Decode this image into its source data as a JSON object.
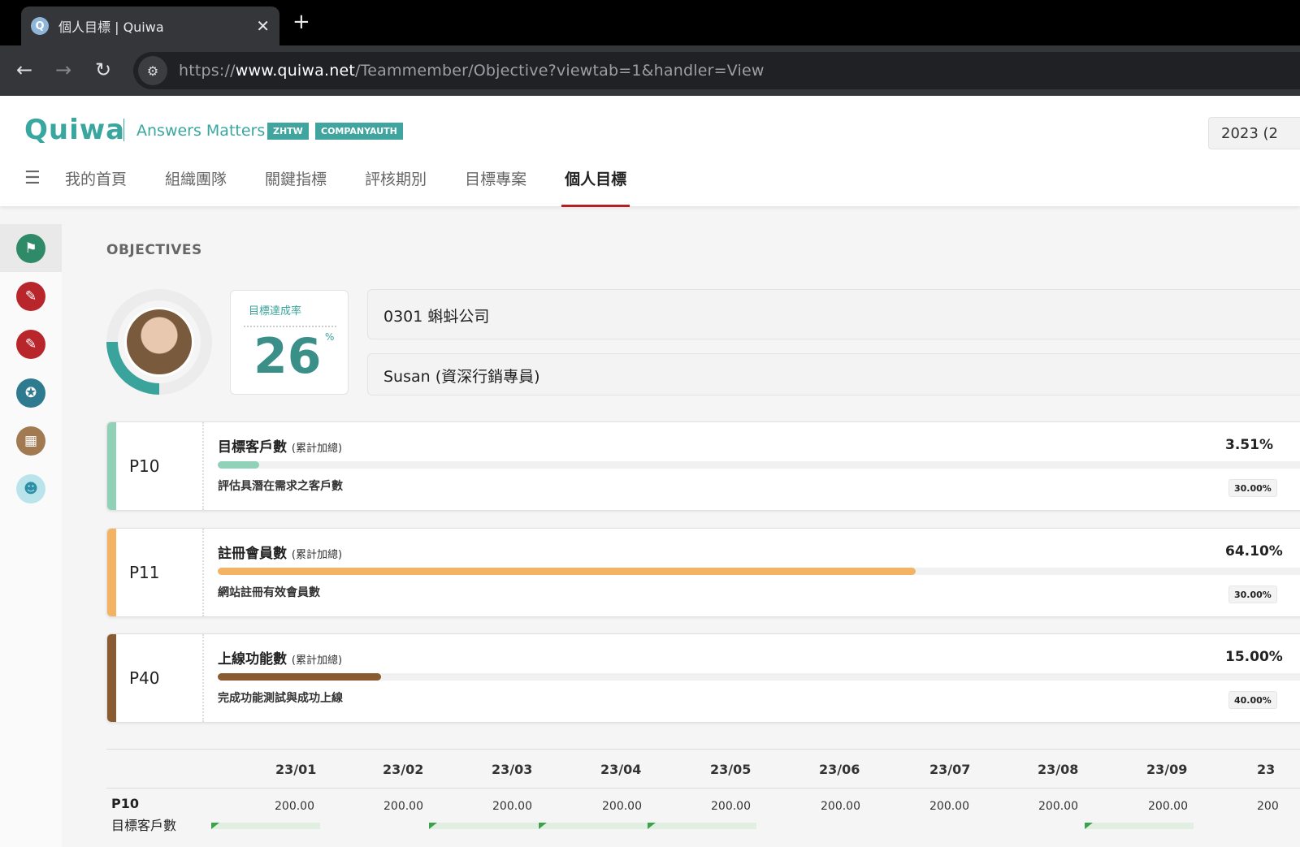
{
  "browser": {
    "tab_title": "個人目標 | Quiwa",
    "favicon_letter": "Q",
    "url_prefix": "https://",
    "url_host": "www.quiwa.net",
    "url_path": "/Teammember/Objective?viewtab=1&handler=View"
  },
  "header": {
    "logo": "Quiwa",
    "tagline": "Answers Matters",
    "badges": [
      "ZHTW",
      "COMPANYAUTH"
    ],
    "year": "2023 (2",
    "menu": [
      "我的首頁",
      "組織團隊",
      "關鍵指標",
      "評核期別",
      "目標專案",
      "個人目標"
    ],
    "active_menu": "個人目標"
  },
  "sidebar": {
    "icons": [
      {
        "name": "flag-icon",
        "color": "#2f8a68"
      },
      {
        "name": "edit-icon",
        "color": "#b8262b"
      },
      {
        "name": "edit-icon",
        "color": "#b8262b"
      },
      {
        "name": "award-icon",
        "color": "#2e7a8f"
      },
      {
        "name": "grid-icon",
        "color": "#a17a52"
      },
      {
        "name": "team-icon",
        "color": "#b9e4ec"
      }
    ]
  },
  "main": {
    "section_title": "OBJECTIVES",
    "rate": {
      "label": "目標達成率",
      "value": "26",
      "unit": "%",
      "ring_fraction": 0.26
    },
    "company": "0301 蝌蚪公司",
    "member": "Susan (資深行銷專員)",
    "objectives": [
      {
        "code": "P10",
        "name": "目標客戶數",
        "mode": "(累計加總)",
        "desc": "評估具潛在需求之客戶數",
        "achievement": "3.51%",
        "progress": 0.0351,
        "weight": "30.00%",
        "color": "#8fd2b7"
      },
      {
        "code": "P11",
        "name": "註冊會員數",
        "mode": "(累計加總)",
        "desc": "網站註冊有效會員數",
        "achievement": "64.10%",
        "progress": 0.641,
        "weight": "30.00%",
        "color": "#f4b363"
      },
      {
        "code": "P40",
        "name": "上線功能數",
        "mode": "(累計加總)",
        "desc": "完成功能測試與成功上線",
        "achievement": "15.00%",
        "progress": 0.15,
        "weight": "40.00%",
        "color": "#8a5a30"
      }
    ],
    "table": {
      "months": [
        "23/01",
        "23/02",
        "23/03",
        "23/04",
        "23/05",
        "23/06",
        "23/07",
        "23/08",
        "23/09",
        "23"
      ],
      "row": {
        "code": "P10",
        "name": "目標客戶數",
        "values": [
          "200.00",
          "200.00",
          "200.00",
          "200.00",
          "200.00",
          "200.00",
          "200.00",
          "200.00",
          "200.00",
          "200"
        ]
      }
    }
  }
}
